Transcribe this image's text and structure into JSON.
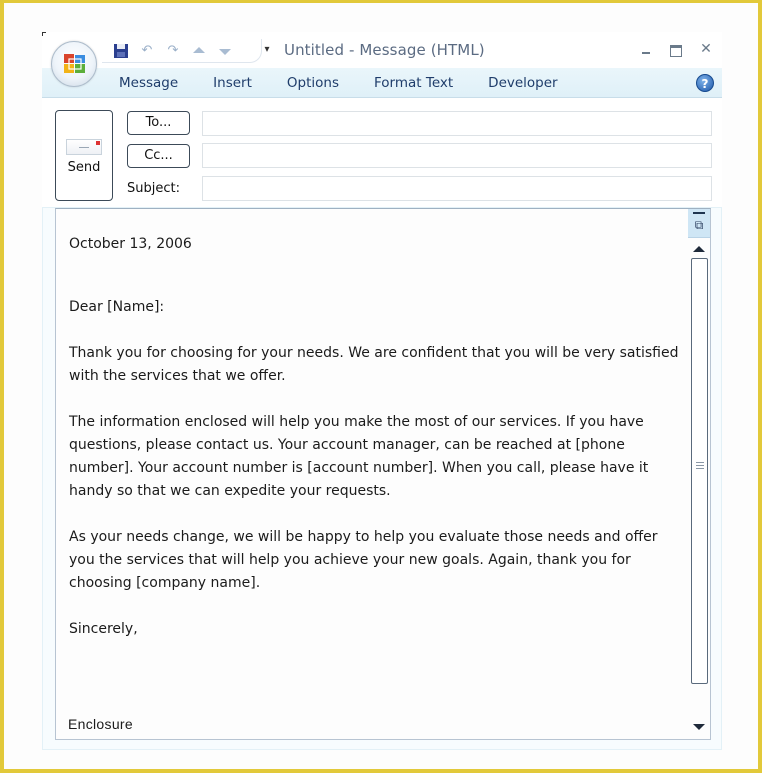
{
  "window": {
    "title": "Untitled - Message (HTML)",
    "controls": {
      "minimize": "minimize",
      "maximize": "maximize",
      "close": "✕"
    }
  },
  "quick_access": {
    "icons": [
      "save-icon",
      "undo-icon",
      "redo-icon",
      "previous-item-icon",
      "next-item-icon"
    ],
    "glyphs": {
      "save": "■",
      "undo": "↶",
      "redo": "↷",
      "prev": "◆",
      "next": "◆"
    },
    "dropdown": "▾"
  },
  "ribbon": {
    "tabs": [
      {
        "label": "Message"
      },
      {
        "label": "Insert"
      },
      {
        "label": "Options"
      },
      {
        "label": "Format Text"
      },
      {
        "label": "Developer"
      }
    ],
    "help": "?"
  },
  "header": {
    "send_label": "Send",
    "to_label": "To...",
    "cc_label": "Cc...",
    "subject_label": "Subject:",
    "to_value": "",
    "cc_value": "",
    "subject_value": ""
  },
  "body": {
    "date": "October 13, 2006",
    "greeting": "Dear [Name]:",
    "paragraphs": [
      "Thank you for choosing for your needs. We are confident that you will be very satisfied with the services that we offer.",
      "The information enclosed will help you make the most of our services. If you have questions, please contact us. Your account manager, can be reached at [phone number]. Your account number is [account number]. When you call, please have it handy so that we can expedite your requests.",
      "As your needs change, we will be happy to help you evaluate those needs and offer you the services that will help you achieve your new goals. Again, thank you for choosing [company name]."
    ],
    "closing": "Sincerely,",
    "enclosure": "Enclosure"
  },
  "scrollbar": {
    "ruler_glyph": "⧉"
  },
  "colors": {
    "frame": "#e2c93a",
    "ribbon_bg": "#dff0f8",
    "tab_text": "#1f3d6b",
    "title_text": "#5b6b82"
  }
}
